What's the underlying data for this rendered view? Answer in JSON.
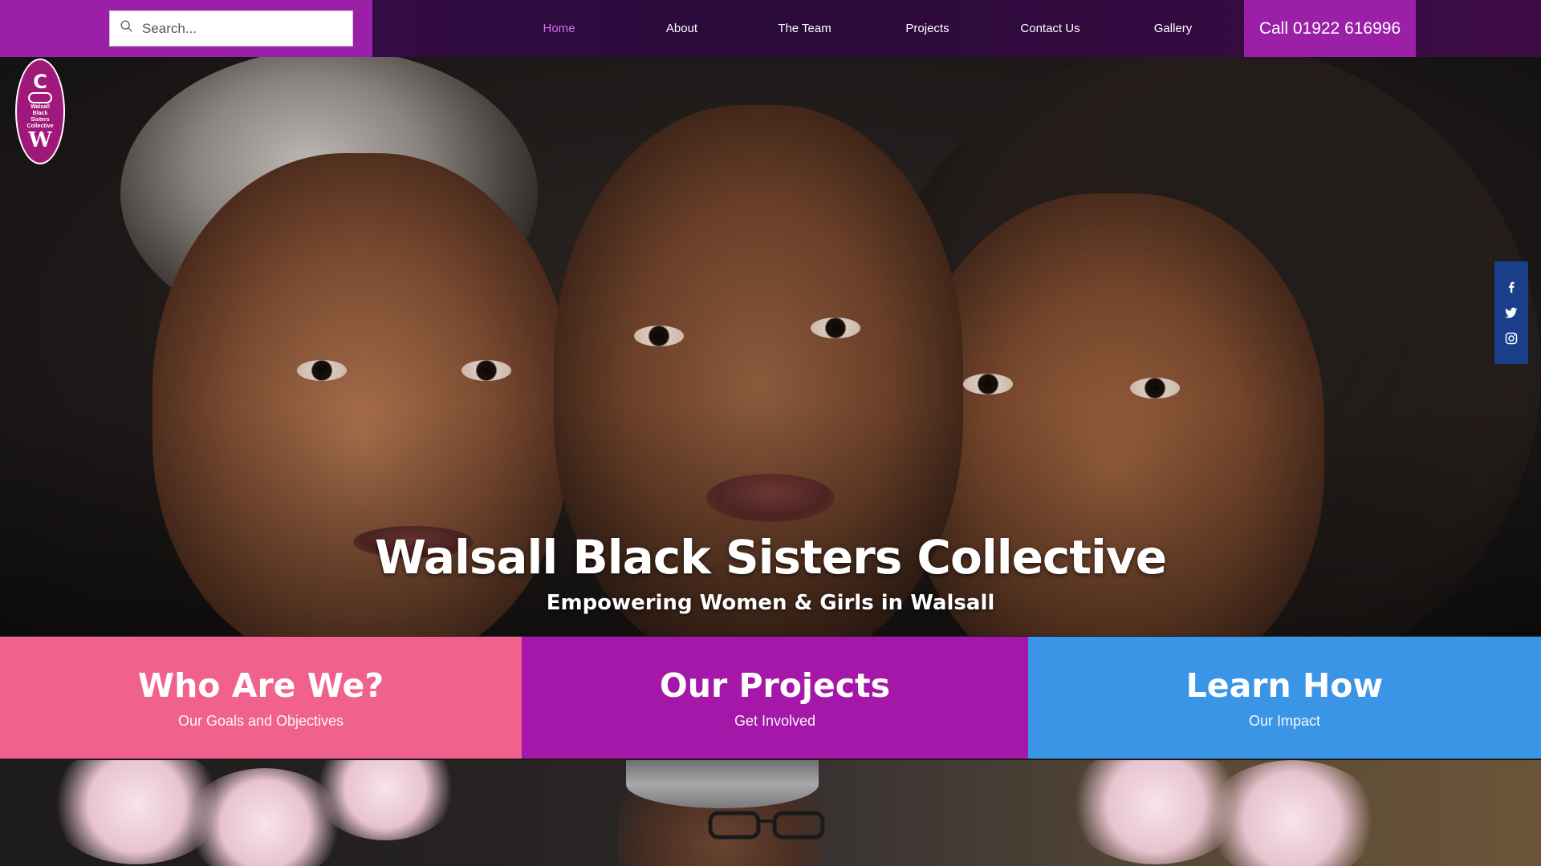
{
  "search": {
    "placeholder": "Search..."
  },
  "nav": {
    "items": [
      {
        "label": "Home",
        "active": true
      },
      {
        "label": "About",
        "active": false
      },
      {
        "label": "The Team",
        "active": false
      },
      {
        "label": "Projects",
        "active": false
      },
      {
        "label": "Contact Us",
        "active": false
      },
      {
        "label": "Gallery",
        "active": false
      }
    ]
  },
  "call_button": {
    "label": "Call 01922 616996"
  },
  "logo": {
    "top_letter": "C",
    "text_lines": [
      "Walsall",
      "Black",
      "Sisters",
      "Collective"
    ],
    "bottom_letter": "W"
  },
  "hero": {
    "title": "Walsall Black Sisters Collective",
    "subtitle": "Empowering Women & Girls in Walsall"
  },
  "social": {
    "icons": [
      "facebook-icon",
      "twitter-icon",
      "instagram-icon"
    ]
  },
  "cards": [
    {
      "title": "Who Are We?",
      "subtitle": "Our Goals and Objectives",
      "color": "#f0628d"
    },
    {
      "title": "Our Projects",
      "subtitle": "Get Involved",
      "color": "#a517a8"
    },
    {
      "title": "Learn How",
      "subtitle": "Our Impact",
      "color": "#3b95e6"
    }
  ],
  "colors": {
    "brand_purple": "#9c1fa8",
    "header_dark": "#3a0d4a",
    "nav_active": "#d56cf0",
    "social_blue": "#1b3e8a"
  }
}
